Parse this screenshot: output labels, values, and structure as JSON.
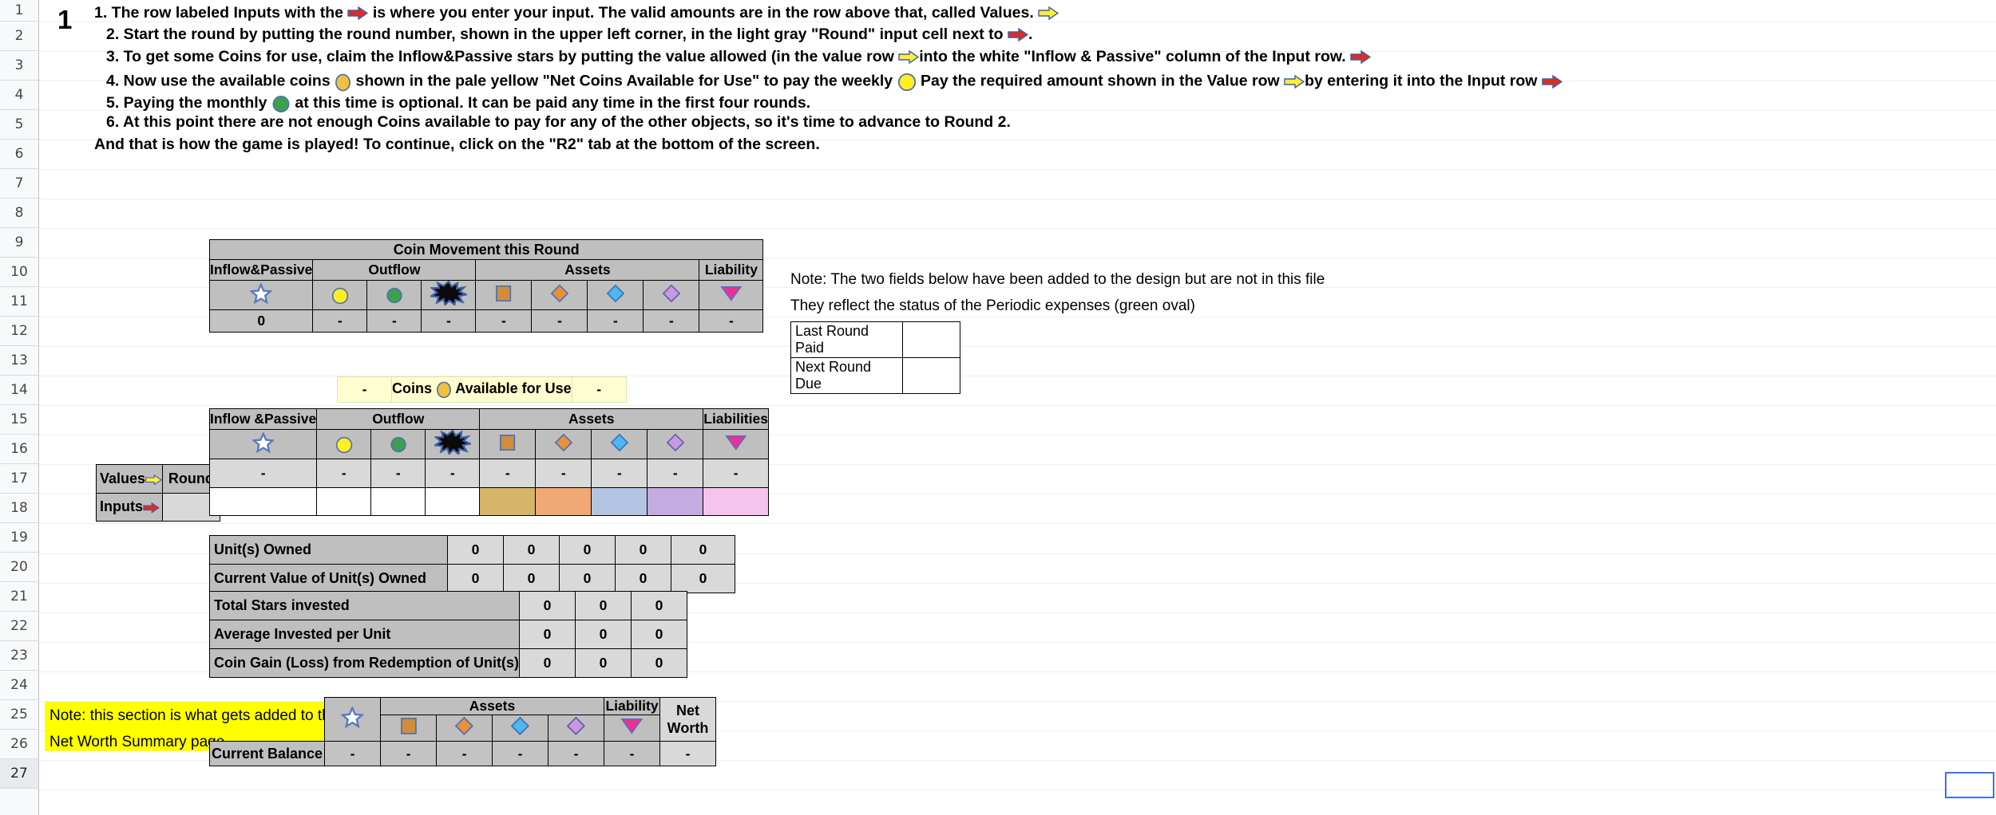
{
  "sheet": {
    "row_numbers": [
      1,
      2,
      3,
      4,
      5,
      6,
      7,
      8,
      9,
      10,
      11,
      12,
      13,
      14,
      15,
      16,
      17,
      18,
      19,
      20,
      21,
      22,
      23,
      24,
      25,
      26,
      27
    ],
    "selected_row": 27,
    "round_badge": "1"
  },
  "instructions": [
    {
      "num": "1.",
      "parts": [
        {
          "t": "text",
          "v": "1.  The row labeled Inputs with the "
        },
        {
          "t": "icon",
          "v": "red-right-arrow-icon"
        },
        {
          "t": "text",
          "v": " is where you enter your input. The valid amounts are in the row above that, called Values.  "
        },
        {
          "t": "icon",
          "v": "yellow-right-arrow-icon"
        }
      ]
    },
    {
      "num": "2.",
      "parts": [
        {
          "t": "text",
          "v": "2.  Start the round by putting the round number, shown in the upper left corner, in the light gray \"Round\" input cell next to  "
        },
        {
          "t": "icon",
          "v": "red-right-arrow-icon"
        },
        {
          "t": "text",
          "v": "."
        }
      ]
    },
    {
      "num": "3.",
      "parts": [
        {
          "t": "text",
          "v": "3. To get some Coins for use, claim the Inflow&Passive stars by putting the value allowed (in the value row  "
        },
        {
          "t": "icon",
          "v": "yellow-right-arrow-icon"
        },
        {
          "t": "text",
          "v": "into the white \"Inflow & Passive\" column of the Input row.   "
        },
        {
          "t": "icon",
          "v": "red-right-arrow-icon"
        }
      ]
    },
    {
      "num": "4.",
      "parts": [
        {
          "t": "text",
          "v": "4.  Now use the available coins  "
        },
        {
          "t": "icon",
          "v": "gold-coin-icon"
        },
        {
          "t": "text",
          "v": "  shown in the pale yellow \"Net Coins Available for Use\" to pay the weekly  "
        },
        {
          "t": "icon",
          "v": "yellow-coin-icon"
        },
        {
          "t": "text",
          "v": " Pay the required amount shown in the Value row  "
        },
        {
          "t": "icon",
          "v": "yellow-right-arrow-icon"
        },
        {
          "t": "text",
          "v": "by entering it into the Input row   "
        },
        {
          "t": "icon",
          "v": "red-right-arrow-icon"
        }
      ]
    },
    {
      "num": "5.",
      "parts": [
        {
          "t": "text",
          "v": "5.  Paying the monthly  "
        },
        {
          "t": "icon",
          "v": "green-oval-icon"
        },
        {
          "t": "text",
          "v": "  at this time is optional. It can be paid any time in the first four rounds."
        }
      ]
    },
    {
      "num": "6.",
      "parts": [
        {
          "t": "text",
          "v": "6.  At this point there are not enough Coins available to pay for any of the other objects, so it's time to advance to Round 2."
        }
      ]
    },
    {
      "num": "",
      "parts": [
        {
          "t": "text",
          "v": "And that is how the game is played!   To continue, click on the \"R2\" tab at the bottom of the screen."
        }
      ]
    }
  ],
  "coin_movement": {
    "title": "Coin Movement this Round",
    "group_headers": [
      "Inflow&Passive",
      "Outflow",
      "Assets",
      "Liability"
    ],
    "symbols": [
      "star-icon",
      "yellow-coin-icon",
      "green-oval-icon",
      "blast-icon",
      "orange-square-icon",
      "orange-diamond-icon",
      "blue-diamond-icon",
      "purple-diamond-icon",
      "pink-triangle-icon"
    ],
    "values": [
      "0",
      "-",
      "-",
      "-",
      "-",
      "-",
      "-",
      "-",
      "-"
    ]
  },
  "coins_available": {
    "left_value": "-",
    "label_prefix": "Coins",
    "label_icon": "gold-coin-icon",
    "label_suffix": "Available for Use",
    "right_value": "-"
  },
  "main_table": {
    "group_headers": [
      "Inflow &Passive",
      "Outflow",
      "Assets",
      "Liabilities"
    ],
    "symbols": [
      "star-icon",
      "yellow-coin-icon",
      "green-oval-icon",
      "blast-icon",
      "orange-square-icon",
      "orange-diamond-icon",
      "blue-diamond-icon",
      "purple-diamond-icon",
      "pink-triangle-icon"
    ],
    "values_label": "Values",
    "values_icon": "yellow-right-arrow-icon",
    "round_label": "Round",
    "values_row": [
      "-",
      "-",
      "-",
      "-",
      "-",
      "-",
      "-",
      "-",
      "-"
    ],
    "inputs_label": "Inputs",
    "inputs_icon": "red-right-arrow-icon",
    "inputs_row": [
      "",
      "",
      "",
      "",
      "",
      "",
      "",
      "",
      ""
    ],
    "summary_rows": [
      {
        "label": "Unit(s) Owned",
        "values": [
          "0",
          "0",
          "0",
          "0",
          "0"
        ]
      },
      {
        "label": "Current Value of  Unit(s) Owned",
        "values": [
          "0",
          "0",
          "0",
          "0",
          "0"
        ]
      },
      {
        "label": "Total Stars invested",
        "values": [
          "0",
          "0",
          "0"
        ]
      },
      {
        "label": "Average Invested per Unit",
        "values": [
          "0",
          "0",
          "0"
        ]
      },
      {
        "label": "Coin Gain (Loss) from Redemption of Unit(s)",
        "values": [
          "0",
          "0",
          "0"
        ]
      }
    ]
  },
  "net_worth_table": {
    "group_headers": [
      "Assets",
      "Liability",
      "Net Worth"
    ],
    "symbols": [
      "star-icon",
      "orange-square-icon",
      "orange-diamond-icon",
      "blue-diamond-icon",
      "purple-diamond-icon",
      "pink-triangle-icon"
    ],
    "balance_label": "Current Balance",
    "balance_values": [
      "-",
      "-",
      "-",
      "-",
      "-",
      "-",
      "-"
    ]
  },
  "bottom_note": {
    "line1": "Note:  this section is what gets added to the",
    "line2": "Net Worth Summary page"
  },
  "side_note": {
    "line1": "Note:  The two fields below have been added to the design but are not in this file",
    "line2": "They reflect the status of the Periodic expenses (green oval)",
    "fields": [
      {
        "label": "Last Round Paid",
        "value": ""
      },
      {
        "label": "Next Round Due",
        "value": ""
      }
    ]
  },
  "colors": {
    "header_gray": "#bfbfbf",
    "value_gray": "#d9d9d9",
    "pale_yellow": "#fdfdcf",
    "highlight_yellow": "#ffff00",
    "tan": "#d5b567",
    "peach": "#f0a875",
    "blue": "#b3c5e3",
    "purple": "#c4abe0",
    "pink": "#f5c4ee",
    "selection_blue": "#3b72e8"
  }
}
